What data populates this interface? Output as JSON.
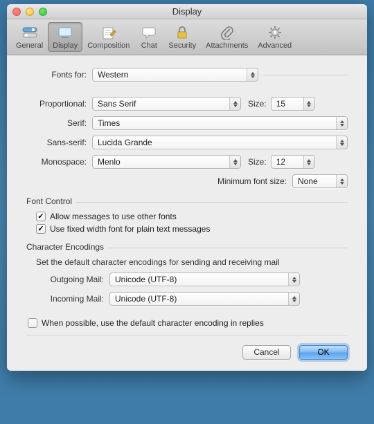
{
  "window": {
    "title": "Display"
  },
  "toolbar": {
    "items": [
      {
        "label": "General"
      },
      {
        "label": "Display"
      },
      {
        "label": "Composition"
      },
      {
        "label": "Chat"
      },
      {
        "label": "Security"
      },
      {
        "label": "Attachments"
      },
      {
        "label": "Advanced"
      }
    ]
  },
  "fonts": {
    "fonts_for_label": "Fonts for:",
    "fonts_for_value": "Western",
    "proportional_label": "Proportional:",
    "proportional_value": "Sans Serif",
    "proportional_size_label": "Size:",
    "proportional_size_value": "15",
    "serif_label": "Serif:",
    "serif_value": "Times",
    "sans_label": "Sans-serif:",
    "sans_value": "Lucida Grande",
    "mono_label": "Monospace:",
    "mono_value": "Menlo",
    "mono_size_label": "Size:",
    "mono_size_value": "12",
    "min_size_label": "Minimum font size:",
    "min_size_value": "None"
  },
  "font_control": {
    "section_label": "Font Control",
    "allow_other_fonts": "Allow messages to use other fonts",
    "allow_other_fonts_checked": true,
    "fixed_width_plain": "Use fixed width font for plain text messages",
    "fixed_width_plain_checked": true
  },
  "encodings": {
    "section_label": "Character Encodings",
    "description": "Set the default character encodings for sending and receiving mail",
    "outgoing_label": "Outgoing Mail:",
    "outgoing_value": "Unicode (UTF-8)",
    "incoming_label": "Incoming Mail:",
    "incoming_value": "Unicode (UTF-8)",
    "use_default_reply": "When possible, use the default character encoding in replies",
    "use_default_reply_checked": false
  },
  "buttons": {
    "cancel": "Cancel",
    "ok": "OK"
  }
}
